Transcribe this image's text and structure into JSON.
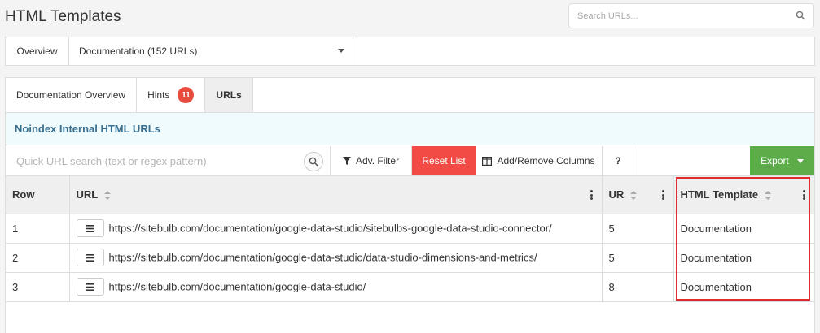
{
  "page": {
    "title": "HTML Templates",
    "search_placeholder": "Search URLs..."
  },
  "selector": {
    "overview_label": "Overview",
    "report_label": "Documentation (152 URLs)"
  },
  "tabs": [
    {
      "label": "Documentation Overview"
    },
    {
      "label": "Hints",
      "badge": "11"
    },
    {
      "label": "URLs"
    }
  ],
  "section": {
    "title": "Noindex Internal HTML URLs"
  },
  "toolbar": {
    "quick_search_placeholder": "Quick URL search (text or regex pattern)",
    "filter_label": "Adv. Filter",
    "reset_label": "Reset List",
    "columns_label": "Add/Remove Columns",
    "help_label": "?",
    "export_label": "Export"
  },
  "table": {
    "columns": [
      "Row",
      "URL",
      "UR",
      "HTML Template"
    ],
    "rows": [
      {
        "row": "1",
        "url": "https://sitebulb.com/documentation/google-data-studio/sitebulbs-google-data-studio-connector/",
        "ur": "5",
        "template": "Documentation"
      },
      {
        "row": "2",
        "url": "https://sitebulb.com/documentation/google-data-studio/data-studio-dimensions-and-metrics/",
        "ur": "5",
        "template": "Documentation"
      },
      {
        "row": "3",
        "url": "https://sitebulb.com/documentation/google-data-studio/",
        "ur": "8",
        "template": "Documentation"
      }
    ]
  },
  "colors": {
    "reset_button": "#f24a44",
    "export_button": "#5cad4a",
    "badge": "#e74c3c",
    "section_title": "#3a6f8f",
    "highlight": "#e32b2b"
  },
  "icons": [
    "search-icon",
    "filter-icon",
    "columns-icon",
    "sort-icon",
    "kebab-icon",
    "menu-icon",
    "caret-down-icon"
  ]
}
